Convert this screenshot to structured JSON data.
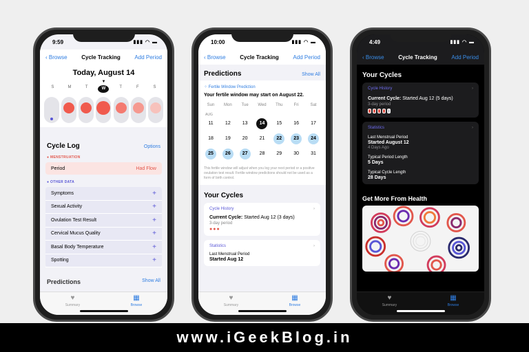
{
  "phone1": {
    "time": "9:59",
    "nav": {
      "back": "Browse",
      "title": "Cycle Tracking",
      "action": "Add Period"
    },
    "date_title": "Today, August 14",
    "weekdays": [
      "S",
      "M",
      "T",
      "W",
      "T",
      "F",
      "S"
    ],
    "circle_colors": [
      "#e4e4e9",
      "#f05a4d",
      "#f05a4d",
      "#f05a4d",
      "#f47a70",
      "#f59990",
      "#f7c2bc",
      "#e4e4e9"
    ],
    "cycle_log": {
      "title": "Cycle Log",
      "action": "Options"
    },
    "menstruation_label": "MENSTRUATION",
    "period": {
      "label": "Period",
      "value": "Had Flow"
    },
    "other_label": "OTHER DATA",
    "other_items": [
      "Symptoms",
      "Sexual Activity",
      "Ovulation Test Result",
      "Cervical Mucus Quality",
      "Basal Body Temperature",
      "Spotting"
    ],
    "peek_title": "Predictions",
    "peek_action": "Show All",
    "tabs": {
      "summary": "Summary",
      "browse": "Browse"
    }
  },
  "phone2": {
    "time": "10:00",
    "nav": {
      "back": "Browse",
      "title": "Cycle Tracking",
      "action": "Add Period"
    },
    "predictions": {
      "title": "Predictions",
      "action": "Show All"
    },
    "fertile_label": "Fertile Window Prediction",
    "fertile_title": "Your fertile window may start on August 22.",
    "cal_weekdays": [
      "Sun",
      "Mon",
      "Tue",
      "Wed",
      "Thu",
      "Fri",
      "Sat"
    ],
    "cal_month": "AUG",
    "cal_rows": [
      [
        "11",
        "12",
        "13",
        "14",
        "15",
        "16",
        "17"
      ],
      [
        "18",
        "19",
        "20",
        "21",
        "22",
        "23",
        "24"
      ],
      [
        "25",
        "26",
        "27",
        "28",
        "29",
        "30",
        "31"
      ]
    ],
    "note": "This fertile window will adjust when you log your next period or a positive ovulation test result. Fertile window predictions should not be used as a form of birth control.",
    "your_cycles": "Your Cycles",
    "cycle_history": "Cycle History",
    "current_cycle_label": "Current Cycle:",
    "current_cycle_value": "Started Aug 12 (3 days)",
    "period_length": "3-day period",
    "statistics": "Statistics",
    "last_period_label": "Last Menstrual Period",
    "last_period_value": "Started Aug 12",
    "tabs": {
      "summary": "Summary",
      "browse": "Browse"
    }
  },
  "phone3": {
    "time": "4:49",
    "nav": {
      "back": "Browse",
      "title": "Cycle Tracking",
      "action": "Add Period"
    },
    "your_cycles": "Your Cycles",
    "cycle_history": "Cycle History",
    "current_cycle_label": "Current Cycle:",
    "current_cycle_value": "Started Aug 12 (5 days)",
    "period_length": "3-day period",
    "statistics": "Statistics",
    "last_period_label": "Last Menstrual Period",
    "last_period_value": "Started August 12",
    "last_period_ago": "4 Days Ago",
    "typical_period_label": "Typical Period Length",
    "typical_period_value": "5 Days",
    "typical_cycle_label": "Typical Cycle Length",
    "typical_cycle_value": "28 Days",
    "get_more": "Get More From Health",
    "tabs": {
      "summary": "Summary",
      "browse": "Browse"
    }
  },
  "footer": "www.iGeekBlog.in",
  "colors": {
    "accent": "#2f7de1",
    "period_red": "#e2574c",
    "purple": "#5856d6",
    "fertile_blue": "#b9ddf5"
  },
  "icons": {
    "status": "signal-wifi-battery-icons",
    "summary_tab": "heart-icon",
    "browse_tab": "grid-icon"
  }
}
